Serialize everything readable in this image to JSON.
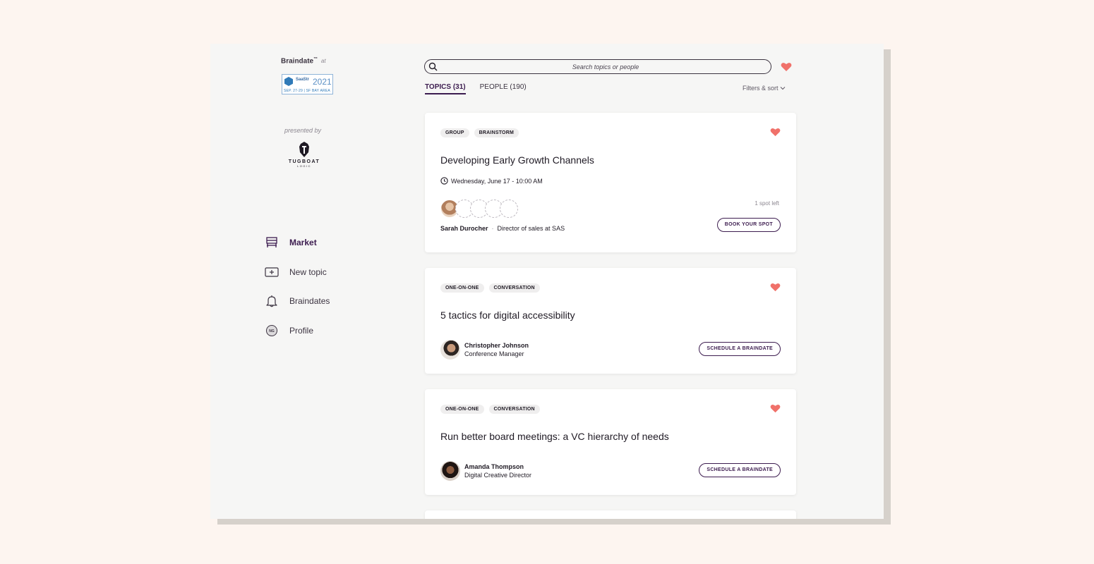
{
  "sidebar": {
    "brand": "Braindate",
    "brand_tm": "™",
    "brand_at": "at",
    "event_logo": {
      "name": "SaaStr",
      "year": "2021",
      "subtitle": "SEP. 27-29 | SF BAY AREA"
    },
    "presented_by": "presented by",
    "sponsor": {
      "name": "TUGBOAT",
      "sub": "LOGIC"
    },
    "nav": [
      {
        "label": "Market",
        "icon": "market-icon",
        "active": true
      },
      {
        "label": "New topic",
        "icon": "plus-box-icon",
        "active": false
      },
      {
        "label": "Braindates",
        "icon": "bell-icon",
        "active": false
      },
      {
        "label": "Profile",
        "icon": "avatar-initials-icon",
        "initials": "NG",
        "active": false
      }
    ]
  },
  "search": {
    "placeholder": "Search topics or people",
    "value": ""
  },
  "tabs": [
    {
      "label": "TOPICS (31)",
      "active": true
    },
    {
      "label": "PEOPLE (190)",
      "active": false
    }
  ],
  "filters_label": "Filters & sort",
  "cards": [
    {
      "tags": [
        "GROUP",
        "BRAINSTORM"
      ],
      "title": "Developing Early Growth Channels",
      "when": "Wednesday, June 17 - 10:00 AM",
      "spots_left": "1 spot left",
      "host_name": "Sarah Durocher",
      "host_role": "Director of sales at SAS",
      "button": "BOOK YOUR SPOT"
    },
    {
      "tags": [
        "ONE-ON-ONE",
        "CONVERSATION"
      ],
      "title": "5 tactics for digital accessibility",
      "host_name": "Christopher Johnson",
      "host_role": "Conference Manager",
      "button": "SCHEDULE A BRAINDATE"
    },
    {
      "tags": [
        "ONE-ON-ONE",
        "CONVERSATION"
      ],
      "title": "Run better board meetings: a VC hierarchy of needs",
      "host_name": "Amanda Thompson",
      "host_role": "Digital Creative Director",
      "button": "SCHEDULE A BRAINDATE"
    }
  ],
  "colors": {
    "accent": "#3c1c4f",
    "heart": "#f0716a",
    "background": "#fdf5f0",
    "panel": "#f6f6f5"
  }
}
